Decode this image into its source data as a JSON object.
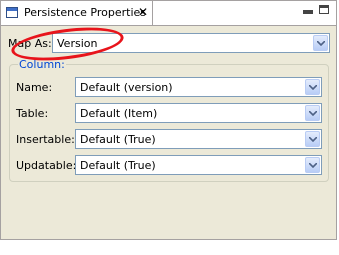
{
  "tab": {
    "title": "Persistence Properties",
    "icon": "properties-view-icon",
    "close_glyph": "✕"
  },
  "map_as": {
    "label": "Map As:",
    "value": "Version"
  },
  "column_group": {
    "title": "Column:",
    "fields": [
      {
        "label": "Name:",
        "value": "Default (version)"
      },
      {
        "label": "Table:",
        "value": "Default (Item)"
      },
      {
        "label": "Insertable:",
        "value": "Default (True)"
      },
      {
        "label": "Updatable:",
        "value": "Default (True)"
      }
    ]
  },
  "colors": {
    "panel_background": "#ece9d8",
    "group_title": "#0046d5",
    "combo_border": "#7f9db9",
    "annotation": "#e8141b"
  }
}
